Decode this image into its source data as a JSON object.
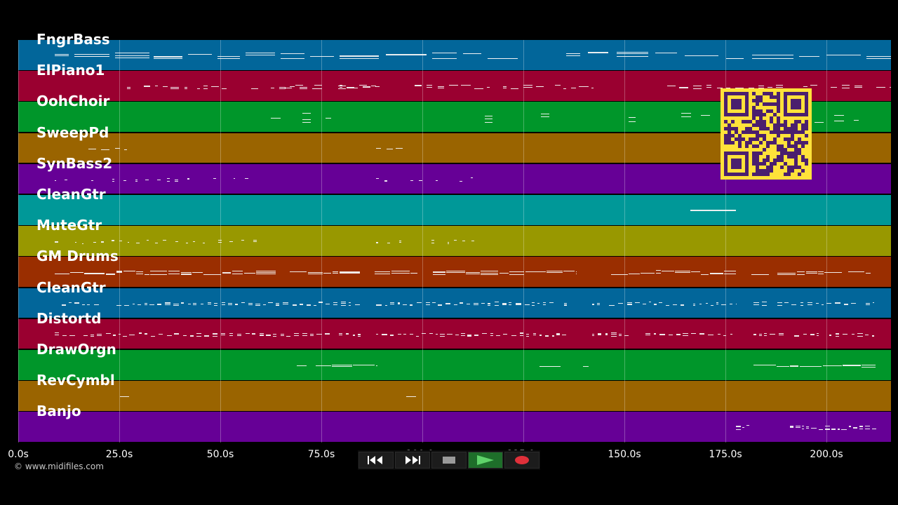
{
  "tracks": [
    {
      "name": "FngrBass",
      "color": "#02669a",
      "pattern": "line"
    },
    {
      "name": "ElPiano1",
      "color": "#9a0030",
      "pattern": "dashed"
    },
    {
      "name": "OohChoir",
      "color": "#00962a",
      "pattern": "sparse"
    },
    {
      "name": "SweepPd",
      "color": "#9a6400",
      "pattern": "few"
    },
    {
      "name": "SynBass2",
      "color": "#660096",
      "pattern": "dotted"
    },
    {
      "name": "CleanGtr",
      "color": "#009898",
      "pattern": "block"
    },
    {
      "name": "MuteGtr",
      "color": "#989800",
      "pattern": "dotted"
    },
    {
      "name": "GM Drums",
      "color": "#9a2e00",
      "pattern": "dense"
    },
    {
      "name": "CleanGtr",
      "color": "#02669a",
      "pattern": "chords"
    },
    {
      "name": "Distortd",
      "color": "#9a0030",
      "pattern": "chords"
    },
    {
      "name": "DrawOrgn",
      "color": "#00962a",
      "pattern": "organ"
    },
    {
      "name": "RevCymbl",
      "color": "#9a6400",
      "pattern": "cymbal"
    },
    {
      "name": "Banjo",
      "color": "#660096",
      "pattern": "banjo"
    }
  ],
  "timeline": {
    "ticks": [
      "0.0s",
      "25.0s",
      "50.0s",
      "75.0s",
      "100.0s",
      "125.0s",
      "150.0s",
      "175.0s",
      "200.0s"
    ]
  },
  "copyright": "© www.midifiles.com",
  "transport": [
    {
      "name": "rewind-button",
      "icon": "rewind-icon"
    },
    {
      "name": "fast-forward-button",
      "icon": "fast-forward-icon"
    },
    {
      "name": "stop-button",
      "icon": "stop-icon"
    },
    {
      "name": "play-button",
      "icon": "play-icon"
    },
    {
      "name": "record-button",
      "icon": "record-icon"
    }
  ],
  "colors": {
    "background": "#000000",
    "qr_background": "#ffe23a",
    "qr_foreground": "#4a1f6e",
    "play_active": "#1e6e2a",
    "record": "#e0303a"
  }
}
